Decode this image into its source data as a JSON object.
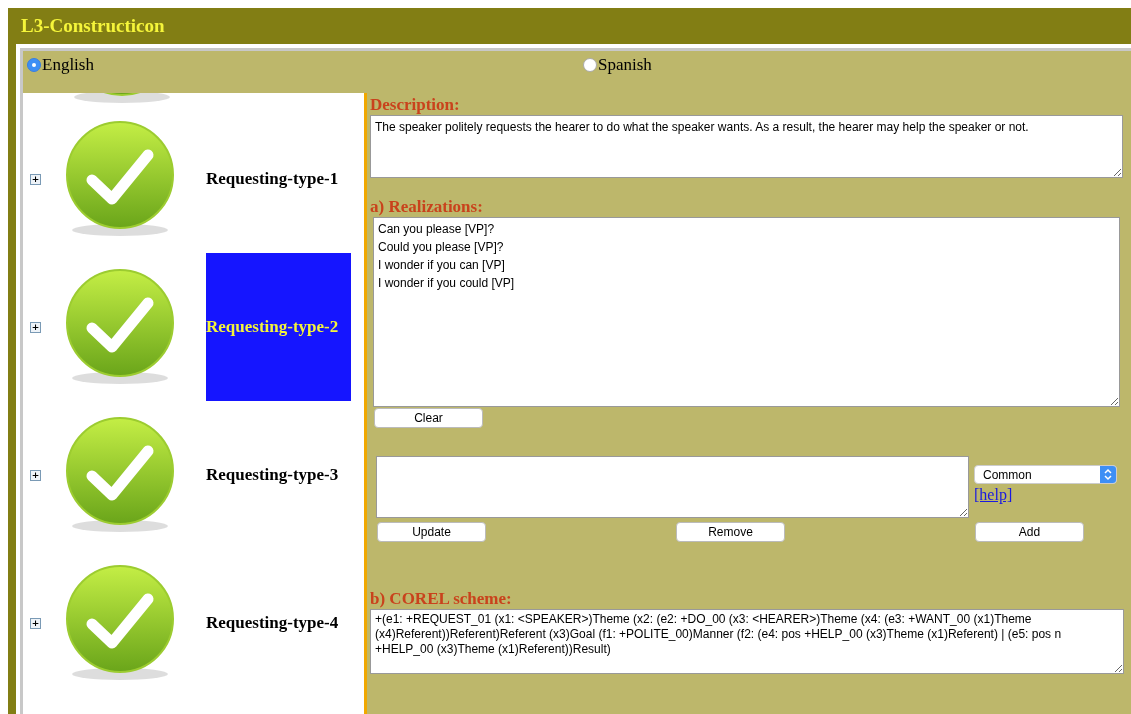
{
  "app_title": "L3-Constructicon",
  "languages": [
    {
      "label": "English",
      "selected": true
    },
    {
      "label": "Spanish",
      "selected": false
    }
  ],
  "constructions": [
    {
      "label": "Requesting-type-1",
      "selected": false,
      "expand_symbol": "+"
    },
    {
      "label": "Requesting-type-2",
      "selected": true,
      "expand_symbol": "+"
    },
    {
      "label": "Requesting-type-3",
      "selected": false,
      "expand_symbol": "+"
    },
    {
      "label": "Requesting-type-4",
      "selected": false,
      "expand_symbol": "+"
    }
  ],
  "description": {
    "label": "Description:",
    "value": "The speaker politely requests the hearer to do what the speaker wants. As a result, the hearer may help the speaker or not."
  },
  "realizations": {
    "label": "a) Realizations:",
    "value": "Can you please [VP]?\nCould you please [VP]?\nI wonder if you can [VP]\nI wonder if you could [VP]",
    "clear_button": "Clear"
  },
  "editor": {
    "type_select": "Common",
    "help_link": "[help]",
    "buttons": [
      "Update",
      "Remove",
      "Add"
    ]
  },
  "corel": {
    "label": "b) COREL scheme:",
    "value": "+(e1: +REQUEST_01 (x1: <SPEAKER>)Theme (x2: (e2: +DO_00 (x3: <HEARER>)Theme (x4: (e3: +WANT_00 (x1)Theme (x4)Referent))Referent)Referent (x3)Goal (f1: +POLITE_00)Manner (f2: (e4: pos +HELP_00 (x3)Theme (x1)Referent) | (e5: pos n +HELP_00 (x3)Theme (x1)Referent))Result)"
  }
}
